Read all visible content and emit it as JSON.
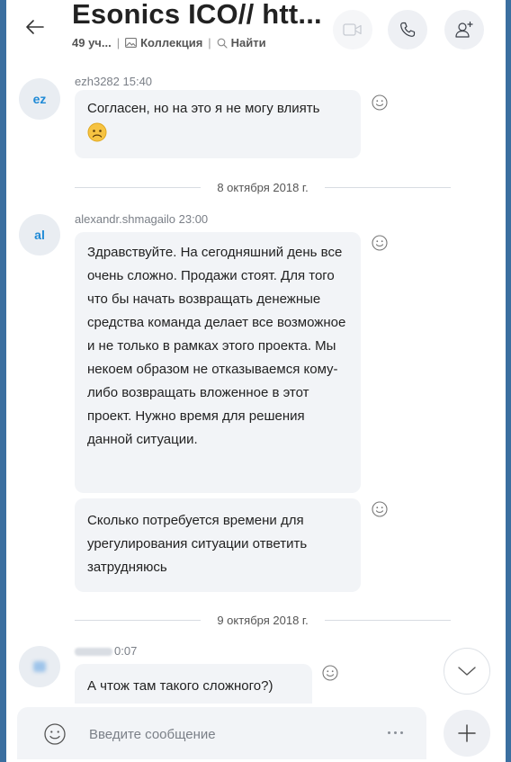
{
  "header": {
    "title": "Esonics ICO// htt...",
    "members": "49 уч...",
    "collection_label": "Коллекция",
    "search_label": "Найти"
  },
  "messages": [
    {
      "avatar": "ez",
      "sender": "ezh3282 15:40",
      "bubbles": [
        "Согласен, но на это я не могу влиять"
      ]
    },
    {
      "date": "8 октября 2018 г."
    },
    {
      "avatar": "al",
      "sender": "alexandr.shmagailo 23:00",
      "bubbles": [
        "Здравствуйте. На сегодняшний день все очень сложно. Продажи стоят. Для того что бы начать возвращать денежные средства команда делает все возможное и не только в рамках этого проекта. Мы некоем образом не отказываемся кому-либо возвращать вложенное в этот проект. Нужно время для решения данной ситуации.",
        "Сколько потребуется времени для урегулирования ситуации ответить затрудняюсь"
      ]
    },
    {
      "date": "9 октября 2018 г."
    },
    {
      "sender_time": "0:07",
      "bubbles": [
        "А чтож там такого сложного?)"
      ]
    }
  ],
  "composer": {
    "placeholder": "Введите сообщение"
  },
  "colors": {
    "accent": "#1f8ad6",
    "bubble": "#f2f4f7",
    "frame_edge": "#3b6fa0"
  }
}
